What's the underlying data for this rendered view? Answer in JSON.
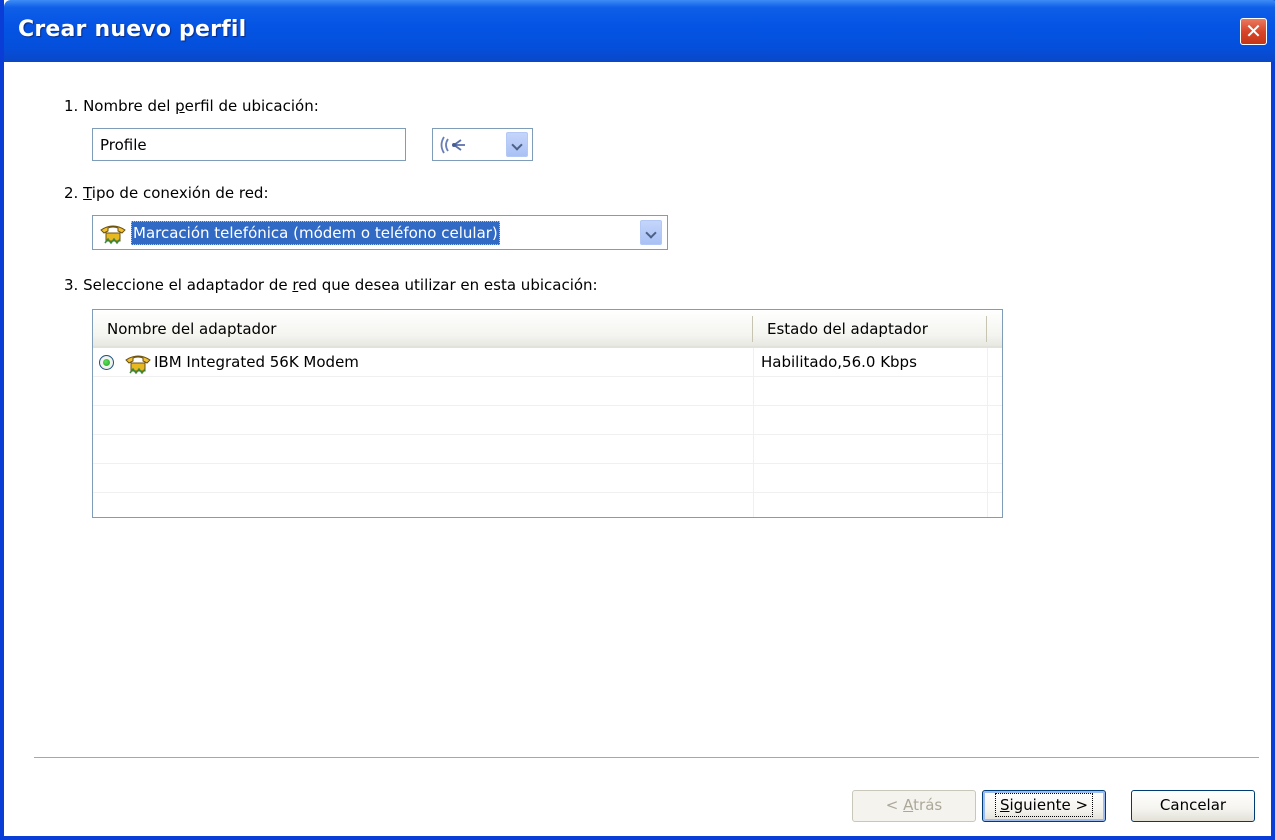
{
  "window": {
    "title": "Crear nuevo perfil",
    "close_label": "✕"
  },
  "step1": {
    "label_prefix": "1. Nombre del ",
    "label_access": "p",
    "label_suffix": "erfil de ubicación:",
    "profile_value": "Profile",
    "icon_combo_icon": "wireless-signal-icon"
  },
  "step2": {
    "label_prefix": "2. ",
    "label_access": "T",
    "label_suffix": "ipo de conexión de red:",
    "selected_value": "Marcación telefónica (módem o teléfono celular)",
    "selected_icon": "modem-phone-icon"
  },
  "step3": {
    "label_prefix": "3. Seleccione el adaptador de ",
    "label_access": "r",
    "label_suffix": "ed que desea utilizar en esta ubicación:"
  },
  "adapter_table": {
    "columns": [
      "Nombre del adaptador",
      "Estado del adaptador"
    ],
    "rows": [
      {
        "name": "IBM Integrated 56K Modem",
        "status": "Habilitado,56.0 Kbps",
        "selected": true,
        "icon": "modem-phone-icon"
      }
    ]
  },
  "buttons": {
    "back_prefix": "< ",
    "back_access": "A",
    "back_suffix": "trás",
    "next_access": "S",
    "next_suffix": "iguiente >",
    "cancel": "Cancelar"
  },
  "colors": {
    "titlebar": "#0554e4",
    "selection": "#316ac5",
    "close": "#d8452a"
  }
}
